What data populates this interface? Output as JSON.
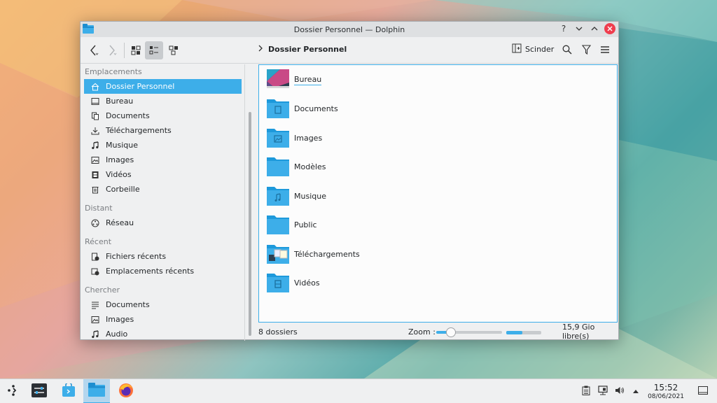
{
  "window": {
    "title": "Dossier Personnel — Dolphin",
    "help_label": "?"
  },
  "toolbar": {
    "breadcrumb_current": "Dossier Personnel",
    "split_label": "Scinder"
  },
  "sidebar": {
    "groups": [
      {
        "label": "Emplacements",
        "items": [
          {
            "label": "Dossier Personnel",
            "icon": "home-icon",
            "selected": true
          },
          {
            "label": "Bureau",
            "icon": "desktop-icon"
          },
          {
            "label": "Documents",
            "icon": "documents-icon"
          },
          {
            "label": "Téléchargements",
            "icon": "download-icon"
          },
          {
            "label": "Musique",
            "icon": "music-icon"
          },
          {
            "label": "Images",
            "icon": "image-icon"
          },
          {
            "label": "Vidéos",
            "icon": "video-icon"
          },
          {
            "label": "Corbeille",
            "icon": "trash-icon"
          }
        ]
      },
      {
        "label": "Distant",
        "items": [
          {
            "label": "Réseau",
            "icon": "network-icon"
          }
        ]
      },
      {
        "label": "Récent",
        "items": [
          {
            "label": "Fichiers récents",
            "icon": "recent-files-icon"
          },
          {
            "label": "Emplacements récents",
            "icon": "recent-places-icon"
          }
        ]
      },
      {
        "label": "Chercher",
        "items": [
          {
            "label": "Documents",
            "icon": "search-documents-icon"
          },
          {
            "label": "Images",
            "icon": "search-images-icon"
          },
          {
            "label": "Audio",
            "icon": "search-audio-icon"
          }
        ]
      }
    ]
  },
  "files": [
    {
      "name": "Bureau",
      "icon": "desktop-folder-icon"
    },
    {
      "name": "Documents",
      "icon": "documents-folder-icon"
    },
    {
      "name": "Images",
      "icon": "pictures-folder-icon"
    },
    {
      "name": "Modèles",
      "icon": "templates-folder-icon"
    },
    {
      "name": "Musique",
      "icon": "music-folder-icon"
    },
    {
      "name": "Public",
      "icon": "public-folder-icon"
    },
    {
      "name": "Téléchargements",
      "icon": "downloads-folder-icon"
    },
    {
      "name": "Vidéos",
      "icon": "videos-folder-icon"
    }
  ],
  "status": {
    "count": "8 dossiers",
    "zoom_label": "Zoom :",
    "zoom_level": 0.22,
    "space_used": 0.45,
    "free_space": "15,9 Gio libre(s)"
  },
  "taskbar": {
    "time": "15:52",
    "date": "08/06/2021"
  },
  "colors": {
    "accent": "#3daee9",
    "close": "#ef3d4e",
    "folder": "#3daee9"
  }
}
